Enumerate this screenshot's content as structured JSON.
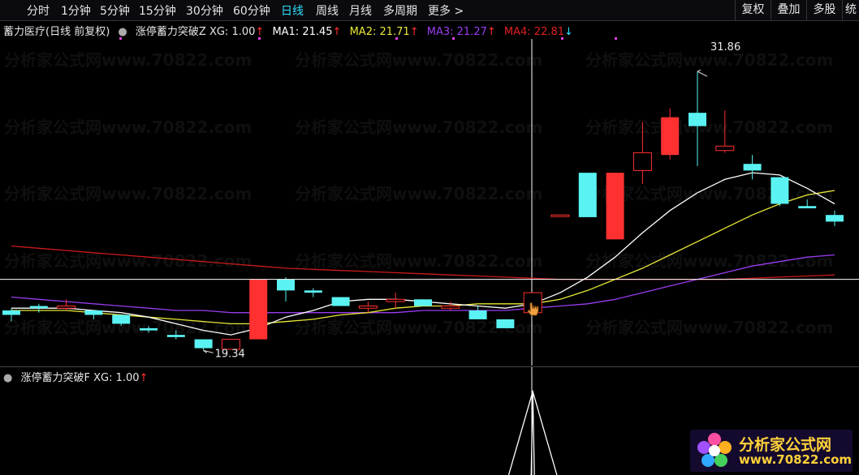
{
  "toolbar": {
    "periods": [
      {
        "label": "分时",
        "active": false
      },
      {
        "label": "1分钟",
        "active": false
      },
      {
        "label": "5分钟",
        "active": false
      },
      {
        "label": "15分钟",
        "active": false
      },
      {
        "label": "30分钟",
        "active": false
      },
      {
        "label": "60分钟",
        "active": false
      },
      {
        "label": "日线",
        "active": true
      },
      {
        "label": "周线",
        "active": false
      },
      {
        "label": "月线",
        "active": false
      },
      {
        "label": "多周期",
        "active": false
      },
      {
        "label": "更多 >",
        "active": false
      }
    ],
    "buttons": [
      "复权",
      "叠加",
      "多股",
      "统"
    ]
  },
  "main_legend": {
    "stock_title": "蓄力医疗(日线 前复权)",
    "indicator_name": "涨停蓄力突破Z",
    "xg": "XG: 1.00",
    "ma1": "MA1: 21.45",
    "ma2": "MA2: 21.71",
    "ma3": "MA3: 21.27",
    "ma4": "MA4: 22.81",
    "arrow_up": "↑",
    "arrow_down": "↓"
  },
  "lower_legend": {
    "indicator_name": "涨停蓄力突破F",
    "xg": "XG: 1.00",
    "arrow_up": "↑"
  },
  "annotations": {
    "high": "31.86",
    "low": "19.34"
  },
  "watermark": "分析家公式网www.70822.com",
  "logo": {
    "name": "分析家公式网",
    "url": "www.70822.com"
  },
  "colors": {
    "up": "#ff3030",
    "down": "#5af2f2",
    "ma1": "#ffffff",
    "ma2": "#e8e838",
    "ma3": "#9a3cf0",
    "ma4": "#cc1a1a",
    "accent": "#2ee0ff"
  },
  "chart_data": {
    "type": "candlestick",
    "price_range": [
      18.8,
      33.4
    ],
    "candles": [
      {
        "o": 21.1,
        "c": 20.9,
        "h": 21.2,
        "l": 20.6
      },
      {
        "o": 21.3,
        "c": 21.2,
        "h": 21.4,
        "l": 21.0
      },
      {
        "o": 21.2,
        "c": 21.3,
        "h": 21.6,
        "l": 21.1
      },
      {
        "o": 21.1,
        "c": 20.9,
        "h": 21.1,
        "l": 20.7
      },
      {
        "o": 20.9,
        "c": 20.5,
        "h": 20.9,
        "l": 20.4
      },
      {
        "o": 20.3,
        "c": 20.2,
        "h": 20.4,
        "l": 20.1
      },
      {
        "o": 20.0,
        "c": 19.9,
        "h": 20.2,
        "l": 19.8
      },
      {
        "o": 19.8,
        "c": 19.4,
        "h": 19.8,
        "l": 19.3
      },
      {
        "o": 19.35,
        "c": 19.8,
        "h": 19.8,
        "l": 19.34
      },
      {
        "o": 19.8,
        "c": 22.5,
        "h": 22.5,
        "l": 19.8
      },
      {
        "o": 22.5,
        "c": 22.0,
        "h": 22.6,
        "l": 21.5
      },
      {
        "o": 22.0,
        "c": 21.9,
        "h": 22.1,
        "l": 21.7
      },
      {
        "o": 21.7,
        "c": 21.3,
        "h": 21.7,
        "l": 21.3
      },
      {
        "o": 21.2,
        "c": 21.3,
        "h": 21.5,
        "l": 21.0
      },
      {
        "o": 21.5,
        "c": 21.6,
        "h": 21.9,
        "l": 21.2
      },
      {
        "o": 21.6,
        "c": 21.3,
        "h": 21.6,
        "l": 21.3
      },
      {
        "o": 21.2,
        "c": 21.3,
        "h": 21.5,
        "l": 21.1
      },
      {
        "o": 21.1,
        "c": 20.7,
        "h": 21.3,
        "l": 20.7
      },
      {
        "o": 20.7,
        "c": 20.3,
        "h": 20.7,
        "l": 20.3
      },
      {
        "o": 21.0,
        "c": 21.9,
        "h": 21.9,
        "l": 21.0
      },
      {
        "o": 25.4,
        "c": 25.4,
        "h": 25.4,
        "l": 25.4
      },
      {
        "o": 27.3,
        "c": 25.3,
        "h": 27.3,
        "l": 25.3
      },
      {
        "o": 24.3,
        "c": 27.3,
        "h": 27.3,
        "l": 24.3
      },
      {
        "o": 27.4,
        "c": 28.2,
        "h": 29.6,
        "l": 26.8
      },
      {
        "o": 28.1,
        "c": 29.8,
        "h": 30.2,
        "l": 27.9
      },
      {
        "o": 30.0,
        "c": 29.4,
        "h": 31.86,
        "l": 27.6
      },
      {
        "o": 28.3,
        "c": 28.5,
        "h": 30.1,
        "l": 28.2
      },
      {
        "o": 27.7,
        "c": 27.4,
        "h": 28.1,
        "l": 27.0
      },
      {
        "o": 27.1,
        "c": 25.9,
        "h": 27.1,
        "l": 25.8
      },
      {
        "o": 25.8,
        "c": 25.7,
        "h": 26.1,
        "l": 25.7
      },
      {
        "o": 25.4,
        "c": 25.1,
        "h": 25.6,
        "l": 24.9
      }
    ],
    "ma1": [
      21.2,
      21.2,
      21.2,
      21.1,
      21.0,
      20.8,
      20.5,
      20.2,
      20.0,
      20.3,
      20.8,
      21.1,
      21.5,
      21.6,
      21.6,
      21.5,
      21.4,
      21.3,
      21.2,
      21.4,
      21.9,
      22.6,
      23.5,
      24.6,
      25.6,
      26.4,
      27.0,
      27.3,
      27.2,
      26.6,
      25.9
    ],
    "ma2": [
      21.1,
      21.1,
      21.1,
      21.0,
      20.9,
      20.8,
      20.7,
      20.6,
      20.5,
      20.5,
      20.6,
      20.7,
      20.9,
      21.0,
      21.2,
      21.3,
      21.3,
      21.4,
      21.4,
      21.4,
      21.6,
      22.0,
      22.5,
      23.0,
      23.6,
      24.2,
      24.8,
      25.4,
      25.9,
      26.3,
      26.5
    ],
    "ma3": [
      21.7,
      21.6,
      21.5,
      21.4,
      21.3,
      21.2,
      21.1,
      21.1,
      21.0,
      21.0,
      21.0,
      21.0,
      21.0,
      21.0,
      21.0,
      21.1,
      21.1,
      21.1,
      21.1,
      21.2,
      21.3,
      21.4,
      21.6,
      21.9,
      22.2,
      22.5,
      22.8,
      23.1,
      23.3,
      23.5,
      23.6
    ],
    "ma4": [
      24.0,
      23.9,
      23.8,
      23.7,
      23.6,
      23.5,
      23.4,
      23.3,
      23.2,
      23.1,
      23.0,
      22.95,
      22.9,
      22.85,
      22.8,
      22.75,
      22.7,
      22.65,
      22.6,
      22.55,
      22.5,
      22.5,
      22.5,
      22.5,
      22.5,
      22.5,
      22.5,
      22.55,
      22.6,
      22.65,
      22.7
    ],
    "crosshair_price": 22.5,
    "crosshair_index": 19,
    "signal_index": 19
  }
}
